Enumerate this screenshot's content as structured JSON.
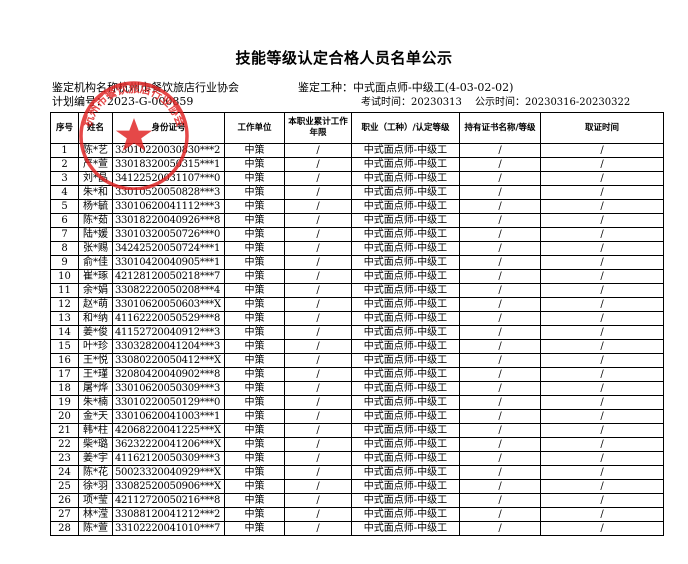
{
  "doc": {
    "title": "技能等级认定合格人员名单公示",
    "org": "鉴定机构名称杭州市餐饮旅店行业协会",
    "plan": "计划编号：2023-G-000859",
    "trade": "鉴定工种：中式面点师-中级工(4-03-02-02)",
    "exam_time": "考试时间：20230313",
    "publish_time": "公示时间：20230316-20230322"
  },
  "stamp": {
    "color": "#e02020",
    "text": "杭州市餐饮旅店行业协会"
  },
  "table": {
    "headers": [
      "序号",
      "姓名",
      "身份证号",
      "工作单位",
      "本职业累计工作年限",
      "职业（工种）/认定等级",
      "持有证书名称/等级",
      "取证时间"
    ],
    "rows": [
      [
        "1",
        "陈*艺",
        "33010220030830***2",
        "中策",
        "/",
        "中式面点师-中级工",
        "/",
        "/"
      ],
      [
        "2",
        "严*萱",
        "33018320050315***1",
        "中策",
        "/",
        "中式面点师-中级工",
        "/",
        "/"
      ],
      [
        "3",
        "刘*晶",
        "34122520031107***0",
        "中策",
        "/",
        "中式面点师-中级工",
        "/",
        "/"
      ],
      [
        "4",
        "朱*和",
        "33010520050828***3",
        "中策",
        "/",
        "中式面点师-中级工",
        "/",
        "/"
      ],
      [
        "5",
        "杨*毓",
        "33010620041112***3",
        "中策",
        "/",
        "中式面点师-中级工",
        "/",
        "/"
      ],
      [
        "6",
        "陈*茹",
        "33018220040926***8",
        "中策",
        "/",
        "中式面点师-中级工",
        "/",
        "/"
      ],
      [
        "7",
        "陆*媛",
        "33010320050726***0",
        "中策",
        "/",
        "中式面点师-中级工",
        "/",
        "/"
      ],
      [
        "8",
        "张*赐",
        "34242520050724***1",
        "中策",
        "/",
        "中式面点师-中级工",
        "/",
        "/"
      ],
      [
        "9",
        "俞*佳",
        "33010420040905***1",
        "中策",
        "/",
        "中式面点师-中级工",
        "/",
        "/"
      ],
      [
        "10",
        "崔*琢",
        "42128120050218***7",
        "中策",
        "/",
        "中式面点师-中级工",
        "/",
        "/"
      ],
      [
        "11",
        "余*娟",
        "33082220050208***4",
        "中策",
        "/",
        "中式面点师-中级工",
        "/",
        "/"
      ],
      [
        "12",
        "赵*萌",
        "33010620050603***X",
        "中策",
        "/",
        "中式面点师-中级工",
        "/",
        "/"
      ],
      [
        "13",
        "和*纳",
        "41162220050529***8",
        "中策",
        "/",
        "中式面点师-中级工",
        "/",
        "/"
      ],
      [
        "14",
        "姜*俊",
        "41152720040912***3",
        "中策",
        "/",
        "中式面点师-中级工",
        "/",
        "/"
      ],
      [
        "15",
        "叶*珍",
        "33032820041204***3",
        "中策",
        "/",
        "中式面点师-中级工",
        "/",
        "/"
      ],
      [
        "16",
        "王*悦",
        "33080220050412***X",
        "中策",
        "/",
        "中式面点师-中级工",
        "/",
        "/"
      ],
      [
        "17",
        "王*瑾",
        "32080420040902***8",
        "中策",
        "/",
        "中式面点师-中级工",
        "/",
        "/"
      ],
      [
        "18",
        "屠*烨",
        "33010620050309***3",
        "中策",
        "/",
        "中式面点师-中级工",
        "/",
        "/"
      ],
      [
        "19",
        "朱*楠",
        "33010220050129***0",
        "中策",
        "/",
        "中式面点师-中级工",
        "/",
        "/"
      ],
      [
        "20",
        "金*天",
        "33010620041003***1",
        "中策",
        "/",
        "中式面点师-中级工",
        "/",
        "/"
      ],
      [
        "21",
        "韩*柱",
        "42068220041225***X",
        "中策",
        "/",
        "中式面点师-中级工",
        "/",
        "/"
      ],
      [
        "22",
        "柴*璐",
        "36232220041206***X",
        "中策",
        "/",
        "中式面点师-中级工",
        "/",
        "/"
      ],
      [
        "23",
        "姜*宇",
        "41162120050309***3",
        "中策",
        "/",
        "中式面点师-中级工",
        "/",
        "/"
      ],
      [
        "24",
        "陈*花",
        "50023320040929***X",
        "中策",
        "/",
        "中式面点师-中级工",
        "/",
        "/"
      ],
      [
        "25",
        "徐*羽",
        "33082520050906***X",
        "中策",
        "/",
        "中式面点师-中级工",
        "/",
        "/"
      ],
      [
        "26",
        "项*莹",
        "42112720050216***8",
        "中策",
        "/",
        "中式面点师-中级工",
        "/",
        "/"
      ],
      [
        "27",
        "林*滢",
        "33088120041212***2",
        "中策",
        "/",
        "中式面点师-中级工",
        "/",
        "/"
      ],
      [
        "28",
        "陈*萱",
        "33102220041010***7",
        "中策",
        "/",
        "中式面点师-中级工",
        "/",
        "/"
      ]
    ]
  }
}
